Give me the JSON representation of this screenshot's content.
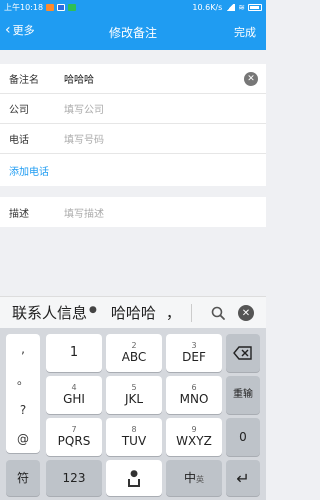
{
  "status_bar": {
    "time": "上午10:18",
    "net_speed": "10.6K/s",
    "battery_icon": "battery-icon"
  },
  "header": {
    "back_label": "更多",
    "title": "修改备注",
    "done_label": "完成"
  },
  "form": {
    "nickname": {
      "label": "备注名",
      "value": "哈哈哈"
    },
    "company": {
      "label": "公司",
      "placeholder": "填写公司"
    },
    "phone": {
      "label": "电话",
      "placeholder": "填写号码"
    },
    "add_phone_label": "添加电话",
    "description": {
      "label": "描述",
      "placeholder": "填写描述"
    }
  },
  "candidate_bar": {
    "candidate_1": "联系人信息",
    "candidate_2": "哈哈哈",
    "candidate_3": "，"
  },
  "keyboard": {
    "symbols": [
      ",",
      "。",
      "?",
      "@"
    ],
    "keys": [
      {
        "num": "",
        "label": "1"
      },
      {
        "num": "2",
        "label": "ABC"
      },
      {
        "num": "3",
        "label": "DEF"
      },
      {
        "num": "4",
        "label": "GHI"
      },
      {
        "num": "5",
        "label": "JKL"
      },
      {
        "num": "6",
        "label": "MNO"
      },
      {
        "num": "7",
        "label": "PQRS"
      },
      {
        "num": "8",
        "label": "TUV"
      },
      {
        "num": "9",
        "label": "WXYZ"
      }
    ],
    "reenter_label": "重输",
    "zero_label": "0",
    "symbol_key_label": "符",
    "num_key_label": "123",
    "lang_key_label": "中",
    "lang_key_sub": "英",
    "backspace_icon": "backspace-icon",
    "enter_icon": "enter-icon"
  }
}
